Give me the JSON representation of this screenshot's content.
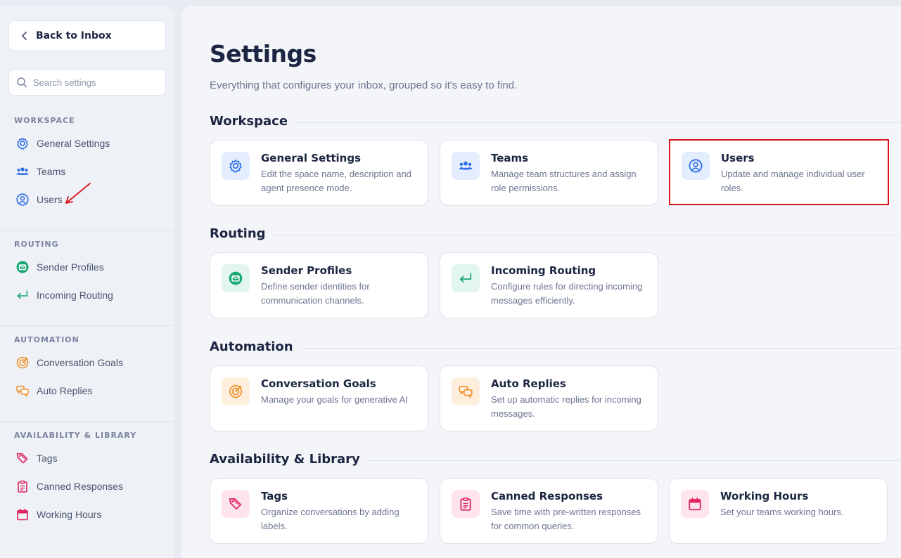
{
  "sidebar": {
    "back_label": "Back to Inbox",
    "search_placeholder": "Search settings",
    "sections": [
      {
        "heading": "WORKSPACE",
        "items": [
          "General Settings",
          "Teams",
          "Users"
        ]
      },
      {
        "heading": "ROUTING",
        "items": [
          "Sender Profiles",
          "Incoming Routing"
        ]
      },
      {
        "heading": "AUTOMATION",
        "items": [
          "Conversation Goals",
          "Auto Replies"
        ]
      },
      {
        "heading": "AVAILABILITY & LIBRARY",
        "items": [
          "Tags",
          "Canned Responses",
          "Working Hours"
        ]
      }
    ]
  },
  "main": {
    "title": "Settings",
    "subtitle": "Everything that configures your inbox, grouped so it's easy to find.",
    "groups": [
      {
        "title": "Workspace",
        "cards": [
          {
            "title": "General Settings",
            "desc": "Edit the space name, description and agent presence mode."
          },
          {
            "title": "Teams",
            "desc": "Manage team structures and assign role permissions."
          },
          {
            "title": "Users",
            "desc": "Update and manage individual user roles."
          }
        ]
      },
      {
        "title": "Routing",
        "cards": [
          {
            "title": "Sender Profiles",
            "desc": "Define sender identities for communication channels."
          },
          {
            "title": "Incoming Routing",
            "desc": "Configure rules for directing incoming messages efficiently."
          }
        ]
      },
      {
        "title": "Automation",
        "cards": [
          {
            "title": "Conversation Goals",
            "desc": "Manage your goals for generative AI"
          },
          {
            "title": "Auto Replies",
            "desc": "Set up automatic replies for incoming messages."
          }
        ]
      },
      {
        "title": "Availability & Library",
        "cards": [
          {
            "title": "Tags",
            "desc": "Organize conversations by adding labels."
          },
          {
            "title": "Canned Responses",
            "desc": "Save time with pre-written responses for common queries."
          },
          {
            "title": "Working Hours",
            "desc": "Set your teams working hours."
          }
        ]
      }
    ]
  },
  "colors": {
    "accent_blue": "#2b6de8",
    "accent_green": "#1aa873",
    "accent_orange": "#f0922e",
    "accent_pink": "#e0245e",
    "highlight_red": "#d9141b"
  }
}
